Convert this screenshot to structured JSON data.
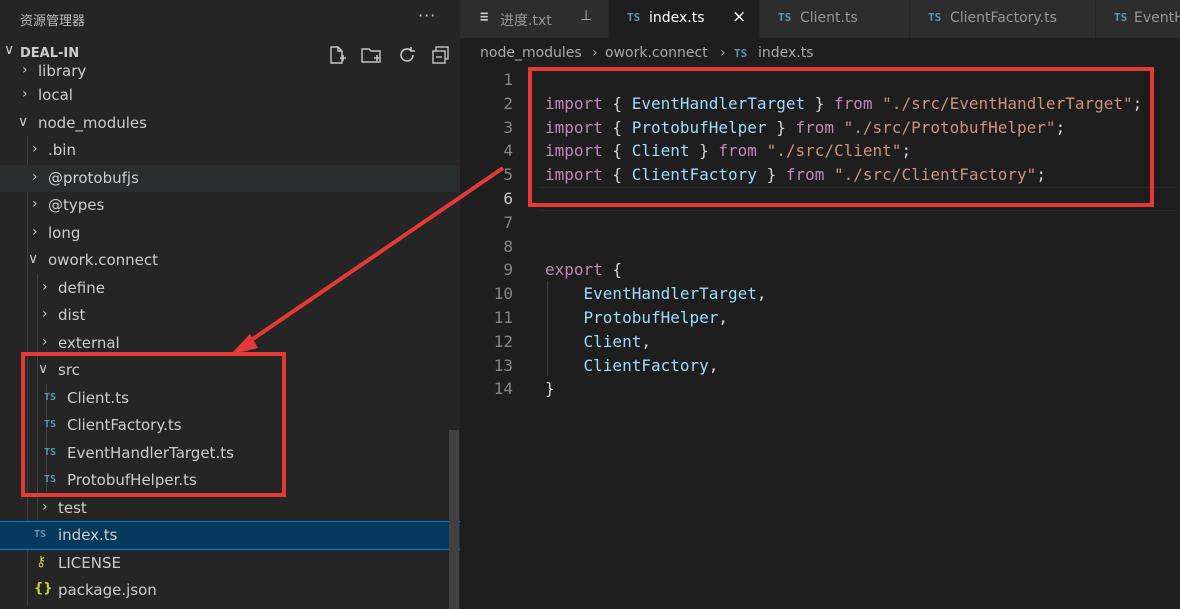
{
  "explorer": {
    "title": "资源管理器",
    "more_glyph": "···",
    "section_chevron": "∨",
    "section_name": "DEAL-IN",
    "tree": [
      {
        "label": "library",
        "chevron": "›",
        "type": "folder"
      },
      {
        "label": "local",
        "chevron": "›",
        "type": "folder"
      },
      {
        "label": "node_modules",
        "chevron": "∨",
        "type": "folder"
      },
      {
        "label": ".bin",
        "chevron": "›",
        "type": "folder"
      },
      {
        "label": "@protobufjs",
        "chevron": "›",
        "type": "folder"
      },
      {
        "label": "@types",
        "chevron": "›",
        "type": "folder"
      },
      {
        "label": "long",
        "chevron": "›",
        "type": "folder"
      },
      {
        "label": "owork.connect",
        "chevron": "∨",
        "type": "folder"
      },
      {
        "label": "define",
        "chevron": "›",
        "type": "folder"
      },
      {
        "label": "dist",
        "chevron": "›",
        "type": "folder"
      },
      {
        "label": "external",
        "chevron": "›",
        "type": "folder"
      },
      {
        "label": "src",
        "chevron": "∨",
        "type": "folder"
      },
      {
        "label": "Client.ts",
        "badge": "TS",
        "type": "ts"
      },
      {
        "label": "ClientFactory.ts",
        "badge": "TS",
        "type": "ts"
      },
      {
        "label": "EventHandlerTarget.ts",
        "badge": "TS",
        "type": "ts"
      },
      {
        "label": "ProtobufHelper.ts",
        "badge": "TS",
        "type": "ts"
      },
      {
        "label": "test",
        "chevron": "›",
        "type": "folder"
      },
      {
        "label": "index.ts",
        "badge": "TS",
        "type": "ts",
        "selected": true
      },
      {
        "label": "LICENSE",
        "badge": "⚷",
        "type": "license"
      },
      {
        "label": "package.json",
        "badge": "{}",
        "type": "json"
      }
    ]
  },
  "tabs": [
    {
      "label": "进度.txt",
      "icon": "≡",
      "pin": "⊥",
      "active": false
    },
    {
      "label": "index.ts",
      "icon": "TS",
      "close": "×",
      "active": true
    },
    {
      "label": "Client.ts",
      "icon": "TS",
      "active": false
    },
    {
      "label": "ClientFactory.ts",
      "icon": "TS",
      "active": false
    },
    {
      "label": "EventH",
      "icon": "TS",
      "active": false
    }
  ],
  "breadcrumb": {
    "items": [
      "node_modules",
      "owork.connect",
      "index.ts"
    ],
    "separator": "›",
    "file_badge": "TS"
  },
  "editor": {
    "line_numbers": [
      "1",
      "2",
      "3",
      "4",
      "5",
      "6",
      "7",
      "8",
      "9",
      "10",
      "11",
      "12",
      "13",
      "14"
    ],
    "current_line": 6,
    "lines": [
      [],
      [
        {
          "t": "import",
          "c": "kw"
        },
        {
          "t": " { ",
          "c": "pn"
        },
        {
          "t": "EventHandlerTarget",
          "c": "id"
        },
        {
          "t": " } ",
          "c": "pn"
        },
        {
          "t": "from",
          "c": "kw"
        },
        {
          "t": " ",
          "c": "pn"
        },
        {
          "t": "\"./src/EventHandlerTarget\"",
          "c": "str"
        },
        {
          "t": ";",
          "c": "pn"
        }
      ],
      [
        {
          "t": "import",
          "c": "kw"
        },
        {
          "t": " { ",
          "c": "pn"
        },
        {
          "t": "ProtobufHelper",
          "c": "id"
        },
        {
          "t": " } ",
          "c": "pn"
        },
        {
          "t": "from",
          "c": "kw"
        },
        {
          "t": " ",
          "c": "pn"
        },
        {
          "t": "\"./src/ProtobufHelper\"",
          "c": "str"
        },
        {
          "t": ";",
          "c": "pn"
        }
      ],
      [
        {
          "t": "import",
          "c": "kw"
        },
        {
          "t": " { ",
          "c": "pn"
        },
        {
          "t": "Client",
          "c": "id"
        },
        {
          "t": " } ",
          "c": "pn"
        },
        {
          "t": "from",
          "c": "kw"
        },
        {
          "t": " ",
          "c": "pn"
        },
        {
          "t": "\"./src/Client\"",
          "c": "str"
        },
        {
          "t": ";",
          "c": "pn"
        }
      ],
      [
        {
          "t": "import",
          "c": "kw"
        },
        {
          "t": " { ",
          "c": "pn"
        },
        {
          "t": "ClientFactory",
          "c": "id"
        },
        {
          "t": " } ",
          "c": "pn"
        },
        {
          "t": "from",
          "c": "kw"
        },
        {
          "t": " ",
          "c": "pn"
        },
        {
          "t": "\"./src/ClientFactory\"",
          "c": "str"
        },
        {
          "t": ";",
          "c": "pn"
        }
      ],
      [],
      [],
      [],
      [
        {
          "t": "export",
          "c": "kw"
        },
        {
          "t": " {",
          "c": "pn"
        }
      ],
      [
        {
          "t": "    EventHandlerTarget",
          "c": "id"
        },
        {
          "t": ",",
          "c": "pn"
        }
      ],
      [
        {
          "t": "    ProtobufHelper",
          "c": "id"
        },
        {
          "t": ",",
          "c": "pn"
        }
      ],
      [
        {
          "t": "    Client",
          "c": "id"
        },
        {
          "t": ",",
          "c": "pn"
        }
      ],
      [
        {
          "t": "    ClientFactory",
          "c": "id"
        },
        {
          "t": ",",
          "c": "pn"
        }
      ],
      [
        {
          "t": "}",
          "c": "pn"
        }
      ]
    ]
  },
  "colors": {
    "annotation_red": "#e53935",
    "ts_blue": "#519aba",
    "selection": "#04395e"
  }
}
